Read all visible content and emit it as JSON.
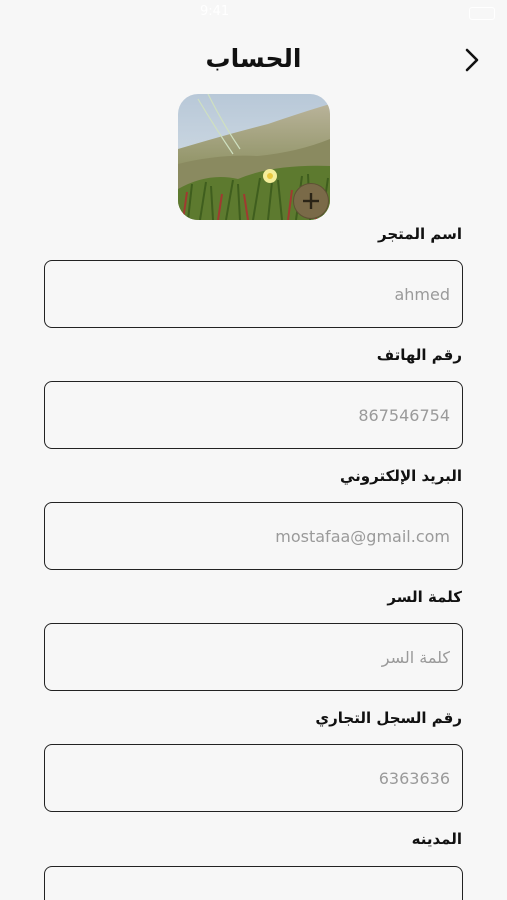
{
  "status_bar": {
    "time": "9:41"
  },
  "header": {
    "title": "الحساب",
    "back_icon": "chevron-icon"
  },
  "avatar": {
    "add_icon": "plus-icon"
  },
  "form": {
    "fields": [
      {
        "label": "اسم المتجر",
        "placeholder": "ahmed"
      },
      {
        "label": "رقم الهاتف",
        "placeholder": "867546754"
      },
      {
        "label": "البريد الإلكتروني",
        "placeholder": "mostafaa@gmail.com"
      },
      {
        "label": "كلمة السر",
        "placeholder": "كلمة السر"
      },
      {
        "label": "رقم السجل التجاري",
        "placeholder": "6363636"
      },
      {
        "label": "المدينه",
        "placeholder": ""
      }
    ]
  },
  "colors": {
    "background": "#f7f7f7",
    "border": "#222222",
    "placeholder": "#9a9a9a",
    "add_button": "#7a6a48"
  }
}
